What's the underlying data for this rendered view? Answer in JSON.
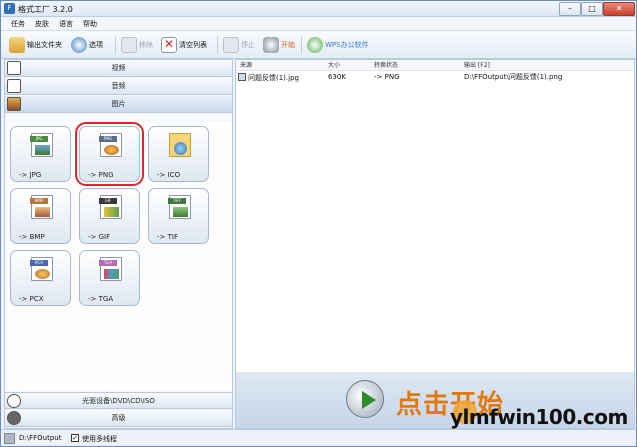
{
  "window": {
    "title": "格式工厂 3.2.0"
  },
  "menu": [
    "任务",
    "皮肤",
    "语言",
    "帮助"
  ],
  "toolbar": {
    "output_folder": "输出文件夹",
    "options": "选项",
    "remove": "移除",
    "clear_list": "清空列表",
    "stop": "停止",
    "start": "开始",
    "wps": "WPS办公软件"
  },
  "categories": {
    "video": "视频",
    "audio": "音频",
    "picture": "图片",
    "rom": "光驱设备\\DVD\\CD\\ISO",
    "advanced": "高级"
  },
  "formats": [
    {
      "label": "-> JPG",
      "tag": "JPG",
      "color": "#4a8a3c",
      "selected": false
    },
    {
      "label": "-> PNG",
      "tag": "PNG",
      "color": "#5a6f8a",
      "selected": true
    },
    {
      "label": "-> ICO",
      "tag": "",
      "color": "#f0b43a",
      "selected": false
    },
    {
      "label": "-> BMP",
      "tag": "BMP",
      "color": "#b8743a",
      "selected": false
    },
    {
      "label": "-> GIF",
      "tag": "GIF",
      "color": "#3a3a3a",
      "selected": false
    },
    {
      "label": "-> TIF",
      "tag": "TIFF",
      "color": "#3f7a3a",
      "selected": false
    },
    {
      "label": "-> PCX",
      "tag": "PCX",
      "color": "#4a6aa8",
      "selected": false
    },
    {
      "label": "-> TGA",
      "tag": "TGA",
      "color": "#b86ab0",
      "selected": false
    }
  ],
  "table": {
    "headers": [
      "来源",
      "大小",
      "转换状态",
      "输出 [F2]"
    ],
    "rows": [
      {
        "source": "问题反馈(1).jpg",
        "size": "630K",
        "status": "-> PNG",
        "output": "D:\\FFOutput\\问题反馈(1).png"
      }
    ]
  },
  "start_banner": "点击开始",
  "status": {
    "output_path": "D:\\FFOutput",
    "multithread_label": "使用多线程",
    "multithread_checked": true
  },
  "watermark": "ylmfwin100.com"
}
